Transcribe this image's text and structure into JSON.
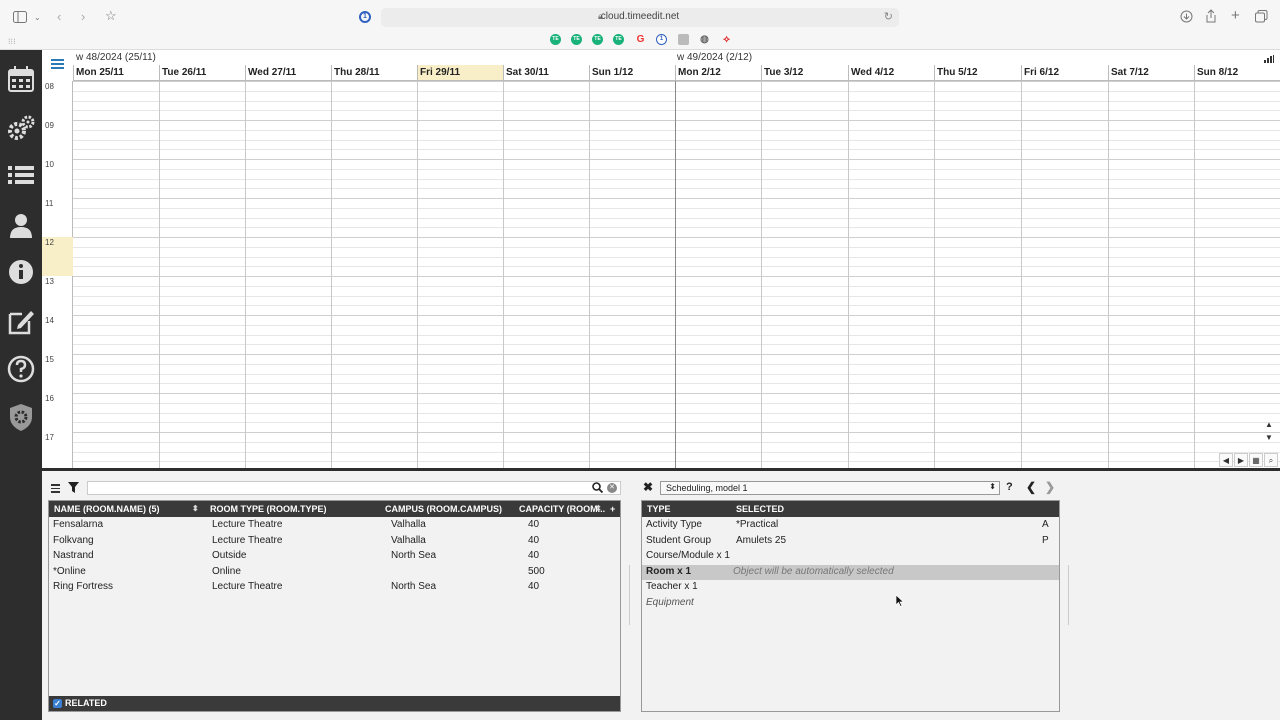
{
  "browser": {
    "url": "cloud.timeedit.net",
    "extensions": [
      "TE",
      "TE",
      "TE",
      "TE",
      "G"
    ]
  },
  "calendar": {
    "week1_label": "w 48/2024 (25/11)",
    "week2_label": "w 49/2024 (2/12)",
    "days": [
      "Mon 25/11",
      "Tue 26/11",
      "Wed 27/11",
      "Thu 28/11",
      "Fri 29/11",
      "Sat 30/11",
      "Sun 1/12",
      "Mon 2/12",
      "Tue 3/12",
      "Wed 4/12",
      "Thu 5/12",
      "Fri 6/12",
      "Sat 7/12",
      "Sun 8/12"
    ],
    "today_index": 4,
    "hours": [
      "08",
      "09",
      "10",
      "11",
      "12",
      "13",
      "14",
      "15",
      "16",
      "17"
    ],
    "highlight_hour": "12"
  },
  "list": {
    "columns": [
      "NAME (ROOM.NAME) (5)",
      "ROOM TYPE (ROOM.TYPE)",
      "CAMPUS (ROOM.CAMPUS)",
      "CAPACITY (ROOM...",
      "+"
    ],
    "rows": [
      {
        "name": "Fensalarna",
        "type": "Lecture Theatre",
        "campus": "Valhalla",
        "capacity": "40"
      },
      {
        "name": "Folkvang",
        "type": "Lecture Theatre",
        "campus": "Valhalla",
        "capacity": "40"
      },
      {
        "name": "Nastrand",
        "type": "Outside",
        "campus": "North Sea",
        "capacity": "40"
      },
      {
        "name": "*Online",
        "type": "Online",
        "campus": "",
        "capacity": "500"
      },
      {
        "name": "Ring Fortress",
        "type": "Lecture Theatre",
        "campus": "North Sea",
        "capacity": "40"
      }
    ],
    "related_label": "RELATED",
    "search_value": ""
  },
  "scheduling": {
    "model": "Scheduling, model 1",
    "help": "?",
    "columns": [
      "TYPE",
      "SELECTED"
    ],
    "rows": [
      {
        "type": "Activity Type",
        "selected": "*Practical",
        "flag": "A"
      },
      {
        "type": "Student Group",
        "selected": "Amulets 25",
        "flag": "P"
      },
      {
        "type": "Course/Module x 1",
        "selected": "",
        "flag": ""
      },
      {
        "type": "Room x 1",
        "selected": "Object will be automatically selected",
        "flag": ""
      },
      {
        "type": "Teacher x 1",
        "selected": "",
        "flag": ""
      },
      {
        "type": "Equipment",
        "selected": "",
        "flag": ""
      }
    ]
  }
}
